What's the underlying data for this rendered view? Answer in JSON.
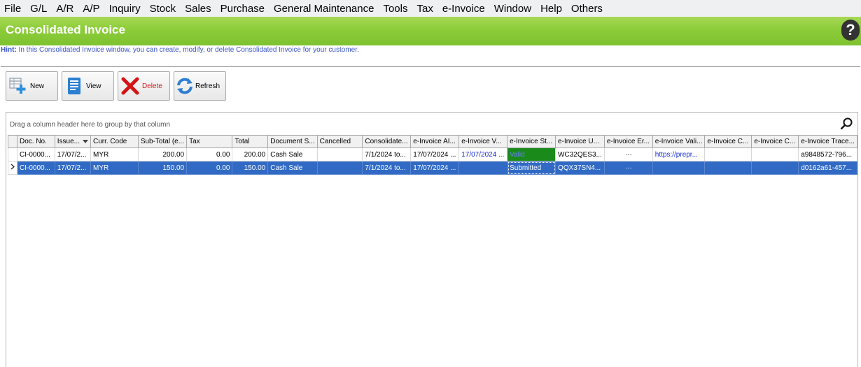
{
  "menu": [
    "File",
    "G/L",
    "A/R",
    "A/P",
    "Inquiry",
    "Stock",
    "Sales",
    "Purchase",
    "General Maintenance",
    "Tools",
    "Tax",
    "e-Invoice",
    "Window",
    "Help",
    "Others"
  ],
  "window": {
    "title": "Consolidated Invoice",
    "help_label": "?"
  },
  "hint": {
    "label": "Hint:",
    "text": " In this Consolidated Invoice window, you can create, modify, or delete Consolidated Invoice for your customer."
  },
  "toolbar": {
    "new_label": "New",
    "view_label": "View",
    "delete_label": "Delete",
    "refresh_label": "Refresh"
  },
  "grid": {
    "group_hint": "Drag a column header here to group by that column",
    "columns": [
      "Doc. No.",
      "Issue...",
      "Curr. Code",
      "Sub-Total (e...",
      "Tax",
      "Total",
      "Document S...",
      "Cancelled",
      "Consolidate...",
      "e-Invoice AI...",
      "e-Invoice V...",
      "e-Invoice St...",
      "e-Invoice U...",
      "e-Invoice Er...",
      "e-Invoice Vali...",
      "e-Invoice C...",
      "e-Invoice C...",
      "e-Invoice Trace..."
    ],
    "rows": [
      [
        "CI-0000...",
        "17/07/2...",
        "MYR",
        "200.00",
        "0.00",
        "200.00",
        "Cash Sale",
        "",
        "7/1/2024 to...",
        "17/07/2024 ...",
        "17/07/2024 ...",
        "Valid",
        "WC32QES3...",
        "···",
        "https://prepr...",
        "",
        "",
        "a9848572-796..."
      ],
      [
        "CI-0000...",
        "17/07/2...",
        "MYR",
        "150.00",
        "0.00",
        "150.00",
        "Cash Sale",
        "",
        "7/1/2024 to...",
        "17/07/2024 ...",
        "",
        "Submitted",
        "QQX37SN4...",
        "···",
        "",
        "",
        "",
        "d0162a61-457..."
      ]
    ]
  },
  "colors": {
    "title_green": "#8ccc3a",
    "selection_blue": "#316ac5",
    "status_green": "#0d7a0d",
    "hint_blue": "#3a55c5"
  }
}
